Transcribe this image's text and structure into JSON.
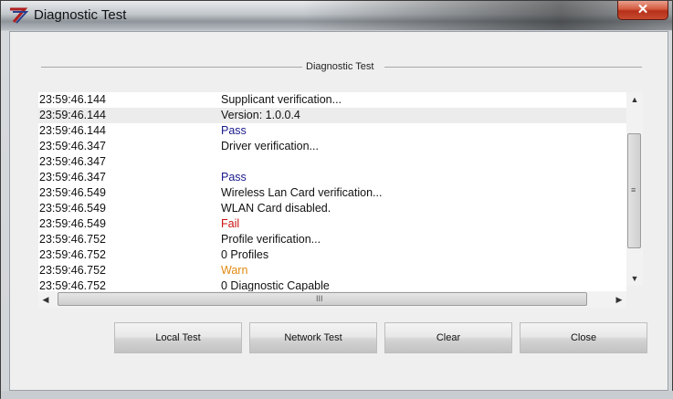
{
  "window": {
    "title": "Diagnostic Test",
    "close_glyph": "✕"
  },
  "group": {
    "label": "Diagnostic Test"
  },
  "log": {
    "rows": [
      {
        "time": "23:59:46.144",
        "message": "Supplicant verification...",
        "color": "#111111"
      },
      {
        "time": "23:59:46.144",
        "message": "Version: 1.0.0.4",
        "color": "#111111"
      },
      {
        "time": "23:59:46.144",
        "message": "Pass",
        "color": "#1a1a8c"
      },
      {
        "time": "23:59:46.347",
        "message": "Driver verification...",
        "color": "#111111"
      },
      {
        "time": "23:59:46.347",
        "message": "",
        "color": "#111111"
      },
      {
        "time": "23:59:46.347",
        "message": "Pass",
        "color": "#1a1a8c"
      },
      {
        "time": "23:59:46.549",
        "message": "Wireless Lan Card verification...",
        "color": "#111111"
      },
      {
        "time": "23:59:46.549",
        "message": "WLAN Card disabled.",
        "color": "#111111"
      },
      {
        "time": "23:59:46.549",
        "message": "Fail",
        "color": "#cc1111"
      },
      {
        "time": "23:59:46.752",
        "message": "Profile verification...",
        "color": "#111111"
      },
      {
        "time": "23:59:46.752",
        "message": "0 Profiles",
        "color": "#111111"
      },
      {
        "time": "23:59:46.752",
        "message": "Warn",
        "color": "#e08a10"
      },
      {
        "time": "23:59:46.752",
        "message": "0 Diagnostic Capable",
        "color": "#111111"
      }
    ],
    "selected_index": 1
  },
  "scrollbars": {
    "up_arrow": "▲",
    "down_arrow": "▼",
    "left_arrow": "◀",
    "right_arrow": "▶",
    "grip_v": "≡",
    "grip_h": "III"
  },
  "buttons": {
    "local_test": "Local Test",
    "network_test": "Network Test",
    "clear": "Clear",
    "close": "Close"
  }
}
